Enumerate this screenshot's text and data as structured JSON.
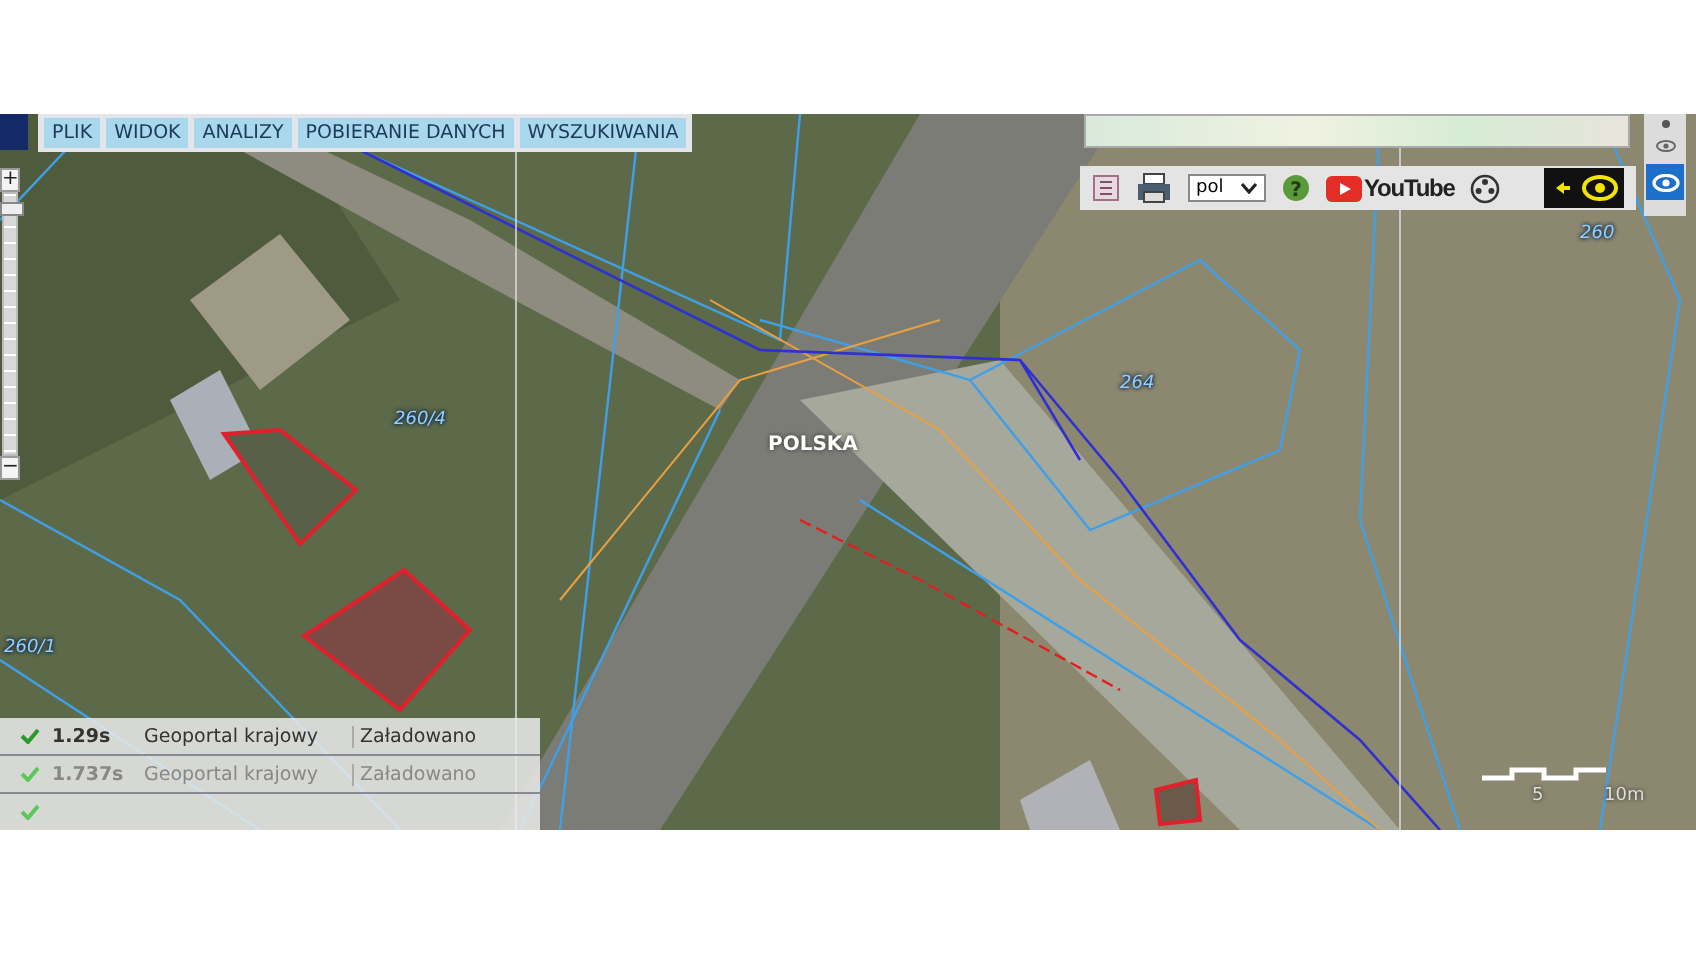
{
  "menu": {
    "items": [
      "PLIK",
      "WIDOK",
      "ANALIZY",
      "POBIERANIE DANYCH",
      "WYSZUKIWANIA"
    ]
  },
  "zoom": {
    "plus": "+",
    "minus": "−",
    "level": 0.97
  },
  "toolbar": {
    "language": "pol",
    "help": "?",
    "youtube": "YouTube",
    "visibility_on": true
  },
  "side_panel": {
    "eye_selected": true
  },
  "map": {
    "labels": [
      "POLSKA",
      "260/4",
      "264",
      "260",
      "260/1"
    ]
  },
  "scale": {
    "labels": [
      "5",
      "10m"
    ]
  },
  "log": {
    "rows": [
      {
        "ok": true,
        "time": "1.29s",
        "source": "Geoportal krajowy",
        "status": "Załadowano",
        "faded": false
      },
      {
        "ok": true,
        "time": "1.737s",
        "source": "Geoportal krajowy",
        "status": "Załadowano",
        "faded": true
      },
      {
        "ok": true,
        "faded": true
      }
    ]
  }
}
